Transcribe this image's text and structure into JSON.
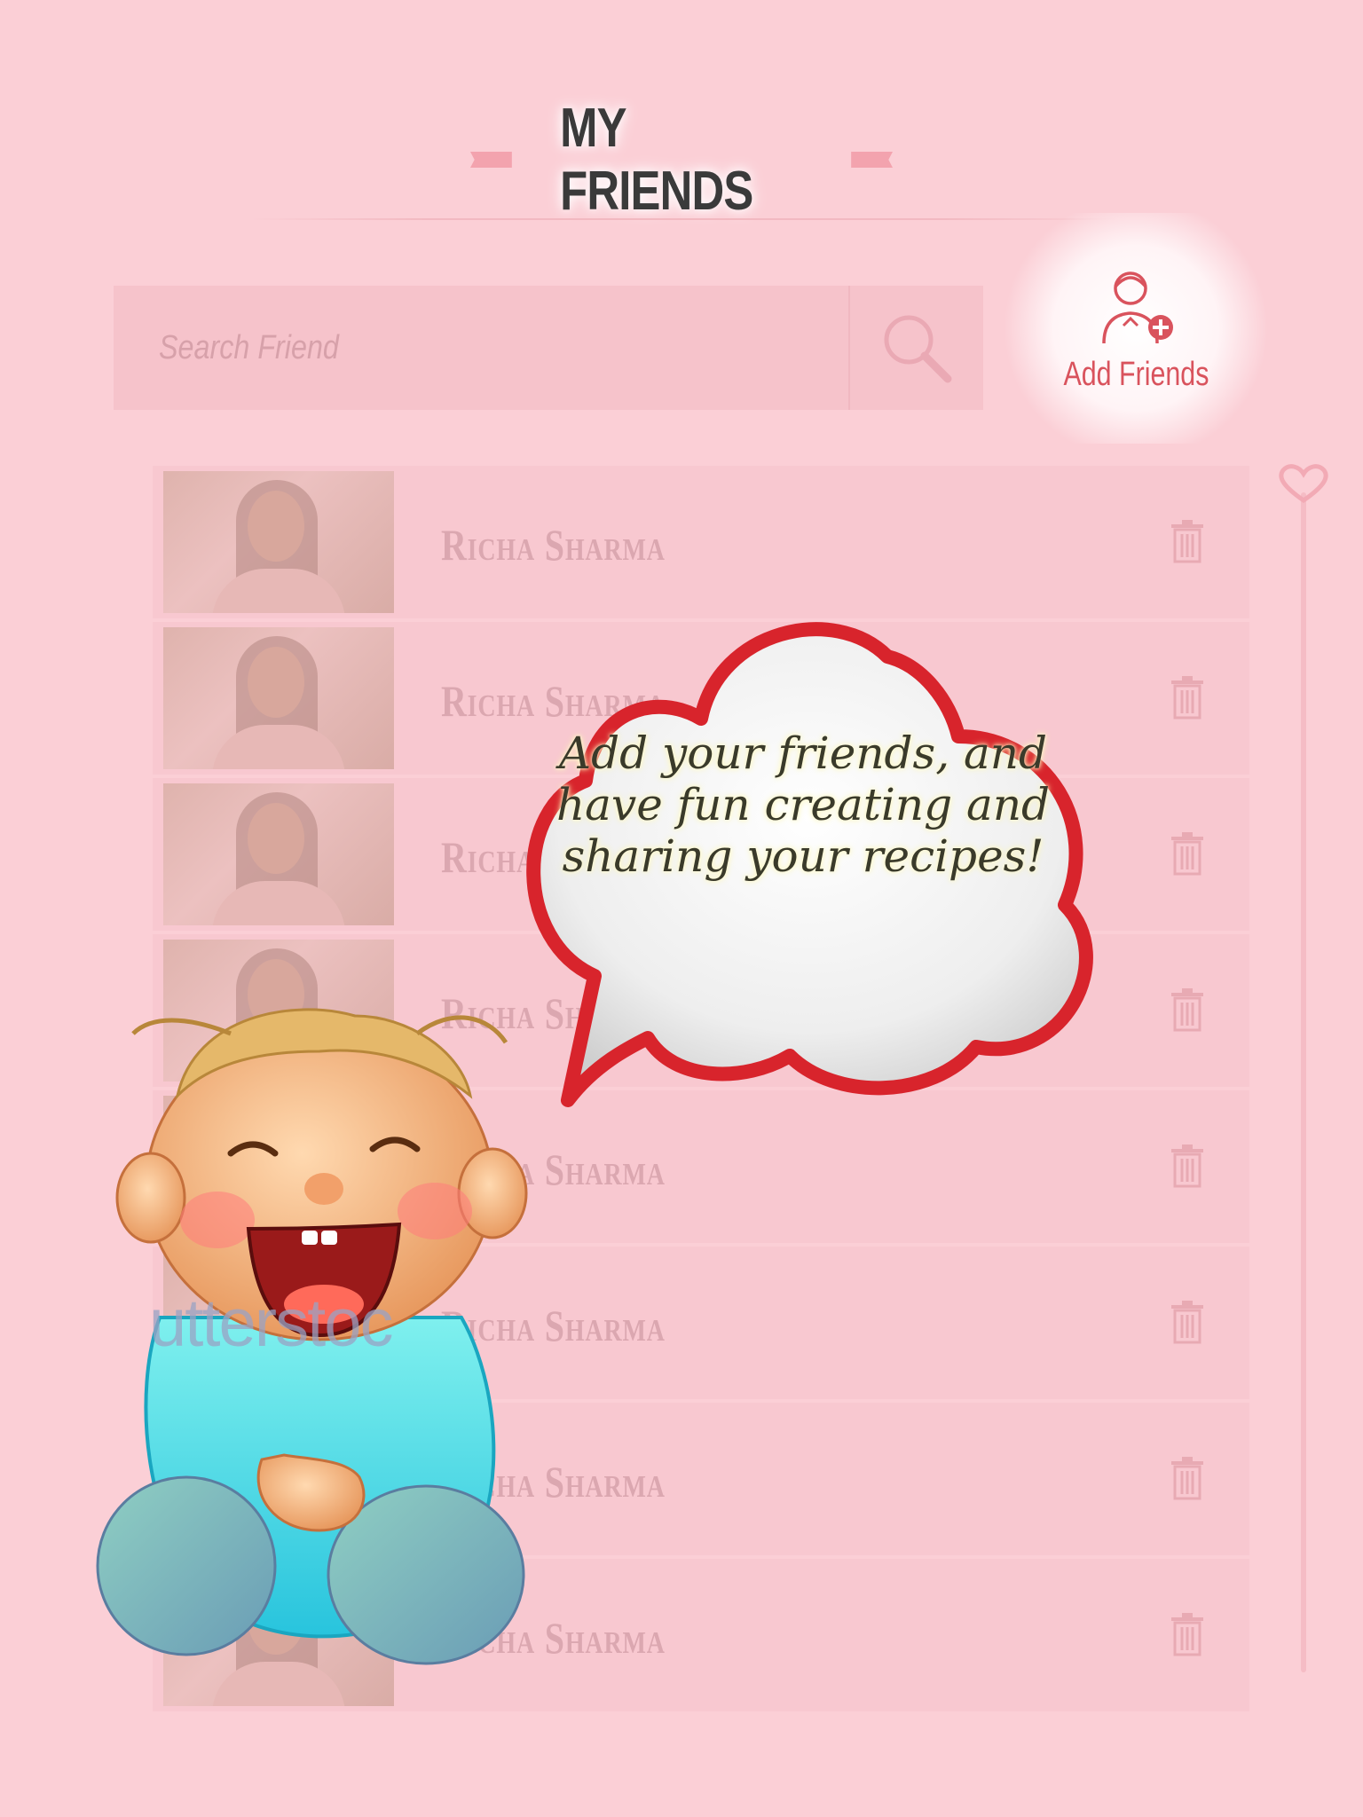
{
  "page": {
    "title": "MY FRIENDS",
    "search_placeholder": "Search Friend",
    "add_friends_label": "Add Friends"
  },
  "friends": [
    {
      "name": "Richa Sharma"
    },
    {
      "name": "Richa Sharma"
    },
    {
      "name": "Richa Sharma"
    },
    {
      "name": "Richa Sharma"
    },
    {
      "name": "Richa Sharma"
    },
    {
      "name": "Richa Sharma"
    },
    {
      "name": "Richa Sharma"
    },
    {
      "name": "Richa Sharma"
    }
  ],
  "overlay": {
    "bubble_text": "Add your friends, and have fun creating and sharing your recipes!",
    "watermark": "utterstoc"
  },
  "icons": {
    "search": "search-icon",
    "add_friend": "add-user-icon",
    "delete": "trash-icon"
  },
  "colors": {
    "background": "#fbcfd6",
    "accent": "#d9535d",
    "bubble_border": "#d8242c"
  }
}
